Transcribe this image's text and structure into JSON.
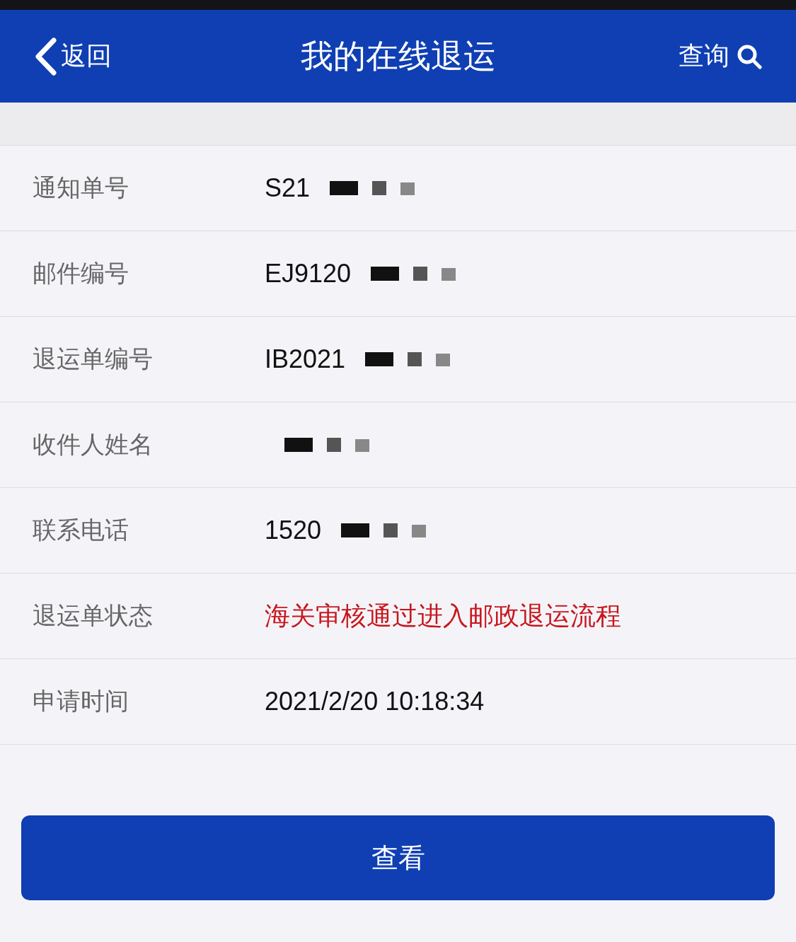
{
  "header": {
    "back": "返回",
    "title": "我的在线退运",
    "search": "查询"
  },
  "rows": [
    {
      "label": "通知单号",
      "value": "S21",
      "kind": "text",
      "redacted": true
    },
    {
      "label": "邮件编号",
      "value": "EJ9120",
      "kind": "text",
      "redacted": true
    },
    {
      "label": "退运单编号",
      "value": "IB2021",
      "kind": "text",
      "redacted": true
    },
    {
      "label": "收件人姓名",
      "kind": "text",
      "redacted": true
    },
    {
      "label": "联系电话",
      "value": "1520",
      "kind": "text",
      "redacted": true
    },
    {
      "label": "退运单状态",
      "value": "海关审核通过进入邮政退运流程",
      "kind": "status",
      "redacted": false
    },
    {
      "label": "申请时间",
      "value": "2021/2/20 10:18:34",
      "kind": "text",
      "redacted": false
    }
  ],
  "button": "查看"
}
